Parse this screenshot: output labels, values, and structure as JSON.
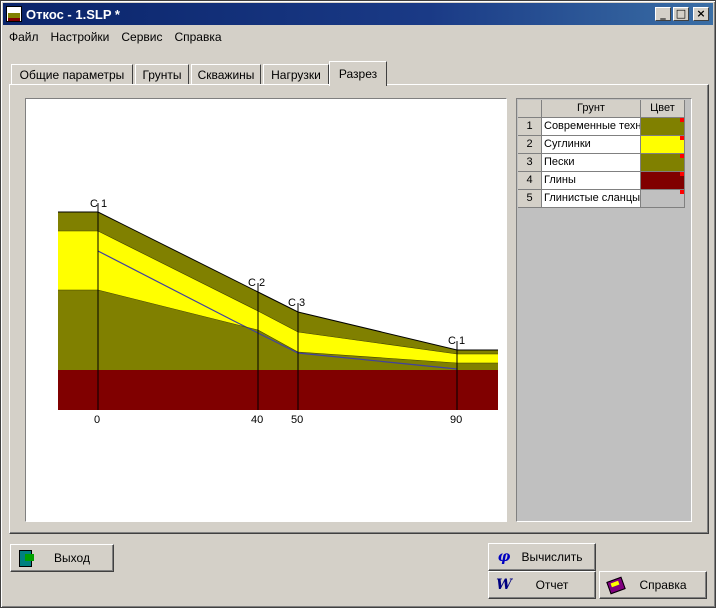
{
  "window": {
    "title": "Откос - 1.SLP *",
    "controls": {
      "minimize": "_",
      "maximize": "□",
      "close": "×"
    }
  },
  "menu": [
    "Файл",
    "Настройки",
    "Сервис",
    "Справка"
  ],
  "tabs": [
    {
      "label": "Общие параметры",
      "active": false
    },
    {
      "label": "Грунты",
      "active": false
    },
    {
      "label": "Скважины",
      "active": false
    },
    {
      "label": "Нагрузки",
      "active": false
    },
    {
      "label": "Разрез",
      "active": true
    }
  ],
  "section": {
    "wells": [
      {
        "name": "С 1",
        "x": 0
      },
      {
        "name": "С 2",
        "x": 40
      },
      {
        "name": "С 3",
        "x": 50
      },
      {
        "name": "С 1",
        "x": 90
      }
    ],
    "x_ticks": [
      "0",
      "40",
      "50",
      "90"
    ],
    "layer_colors": {
      "olive": "#808000",
      "yellow": "#ffff00",
      "maroon": "#800000",
      "line": "#4040a0"
    }
  },
  "soil_table": {
    "headers": {
      "num": "",
      "name": "Грунт",
      "color": "Цвет"
    },
    "rows": [
      {
        "num": "1",
        "name": "Современные техногенные",
        "color": "#808000"
      },
      {
        "num": "2",
        "name": "Суглинки",
        "color": "#ffff00"
      },
      {
        "num": "3",
        "name": "Пески",
        "color": "#808000"
      },
      {
        "num": "4",
        "name": "Глины",
        "color": "#800000"
      },
      {
        "num": "5",
        "name": "Глинистые сланцы",
        "color": "#c0c0c0"
      }
    ]
  },
  "buttons": {
    "exit": "Выход",
    "calculate": "Вычислить",
    "report": "Отчет",
    "help": "Справка"
  }
}
